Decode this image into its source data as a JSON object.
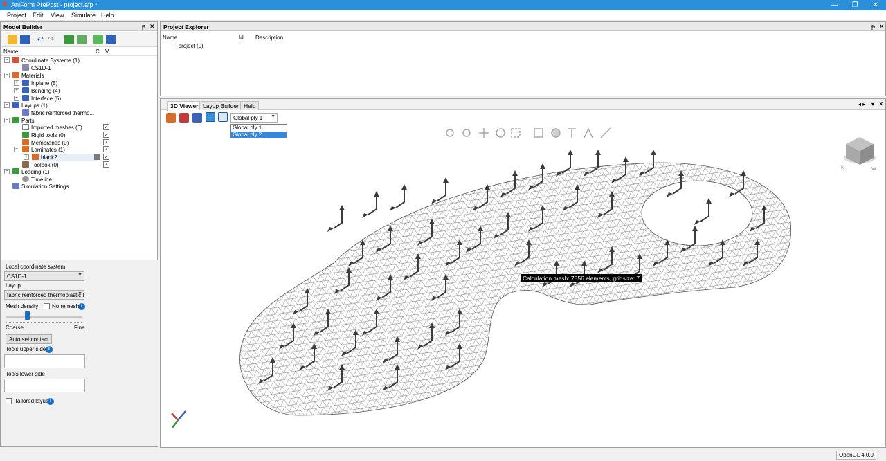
{
  "window": {
    "title": "AniForm PrePost - project.afp *"
  },
  "menu": [
    "Project",
    "Edit",
    "View",
    "Simulate",
    "Help"
  ],
  "model_builder": {
    "title": "Model Builder",
    "columns": {
      "name": "Name",
      "c": "C",
      "v": "V"
    },
    "tree": {
      "coord_systems": "Coordinate Systems (1)",
      "cs1d": "CS1D-1",
      "materials": "Materials",
      "inplane": "Inplane (5)",
      "bending": "Bending (4)",
      "interface": "Interface (5)",
      "layups": "Layups (1)",
      "layup_item": "fabric reinforced thermo...",
      "parts": "Parts",
      "imported_meshes": "Imported meshes (0)",
      "rigid_tools": "Rigid tools (0)",
      "membranes": "Membranes (0)",
      "laminates": "Laminates (1)",
      "blank2": "blank2",
      "toolbox": "Toolbox (0)",
      "loading": "Loading (1)",
      "timeline": "Timeline",
      "sim_settings": "Simulation Settings"
    }
  },
  "properties": {
    "local_cs_label": "Local coordinate system",
    "local_cs_value": "CS1D-1",
    "layup_label": "Layup",
    "layup_value": "fabric reinforced thermoplastic M",
    "mesh_density_label": "Mesh density",
    "no_remesh_label": "No remesh",
    "mesh_density_level": 0.28,
    "coarse_label": "Coarse",
    "fine_label": "Fine",
    "auto_contact_button": "Auto set contact",
    "tools_upper_label": "Tools upper side",
    "tools_lower_label": "Tools lower side",
    "tailored_layup_label": "Tailored layup"
  },
  "project_explorer": {
    "title": "Project Explorer",
    "columns": {
      "name": "Name",
      "id": "Id",
      "description": "Description"
    },
    "root": "project (0)"
  },
  "viewer": {
    "tabs": [
      "3D Viewer",
      "Layup Builder",
      "Help"
    ],
    "ply_selected": "Global ply 1",
    "ply_options": [
      "Global ply 1",
      "Global ply 2"
    ],
    "tooltip": "Calculation mesh: 7856 elements, gridsize: 7",
    "cube_labels": [
      "N",
      "W"
    ]
  },
  "status": {
    "opengl": "OpenGL 4.0.0"
  },
  "colors": {
    "titlebar": "#2b90d9",
    "selection": "#3b86d6",
    "mesh": "#555555"
  }
}
